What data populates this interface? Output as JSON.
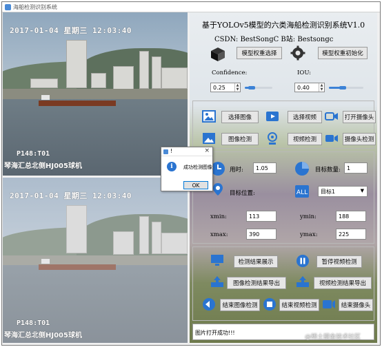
{
  "window": {
    "title": "海船检测识别系统"
  },
  "video_top": {
    "timestamp": "2017-01-04  星期三  12:03:40",
    "camera_id": "P148:T01",
    "place": "琴海汇总北侧HJ005球机"
  },
  "video_bottom": {
    "timestamp": "2017-01-04  星期三  12:03:40",
    "camera_id": "P148:T01",
    "place": "琴海汇总北侧HJ005球机"
  },
  "header": {
    "title": "基于YOLOv5模型的六类海船检测识别系统V1.0",
    "csdn": "CSDN: BestSongC   B站: Bestsongc"
  },
  "weights": {
    "select_label": "模型权重选择",
    "init_label": "模型权重初始化"
  },
  "params": {
    "confidence_label": "Confidence:",
    "confidence_value": "0.25",
    "confidence_level": 0.25,
    "iou_label": "IOU:",
    "iou_value": "0.40",
    "iou_level": 0.4
  },
  "actions": {
    "select_image": "选择图像",
    "select_video": "选择视频",
    "open_camera": "打开摄像头",
    "image_detect": "图像检测",
    "video_detect": "视频检测",
    "camera_detect": "摄像头检测"
  },
  "results": {
    "time_label": "用时:",
    "time_value": "1.05",
    "count_label": "目标数量:",
    "count_value": "1",
    "position_label": "目标位置:",
    "target_select": "目标1",
    "xmin_label": "xmin:",
    "xmin_value": "113",
    "ymin_label": "ymin:",
    "ymin_value": "188",
    "xmax_label": "xmax:",
    "xmax_value": "390",
    "ymax_label": "ymax:",
    "ymax_value": "225"
  },
  "outputs": {
    "show_results": "检测结果展示",
    "pause_video": "暂停视频检测",
    "export_image": "图像检测结果导出",
    "export_video": "视频检测结果导出",
    "end_image": "结束图像检测",
    "end_video": "结束视频检测",
    "end_camera": "结束摄像头"
  },
  "status": {
    "text": "图片打开成功!!!"
  },
  "dialog": {
    "title": "!",
    "close": "×",
    "info_glyph": "i",
    "message": "成功检测图像",
    "ok": "OK"
  },
  "watermark": "@稀土掘金技术社区",
  "colors": {
    "accent": "#3c82d6",
    "icon_blue": "#2a74d0"
  }
}
